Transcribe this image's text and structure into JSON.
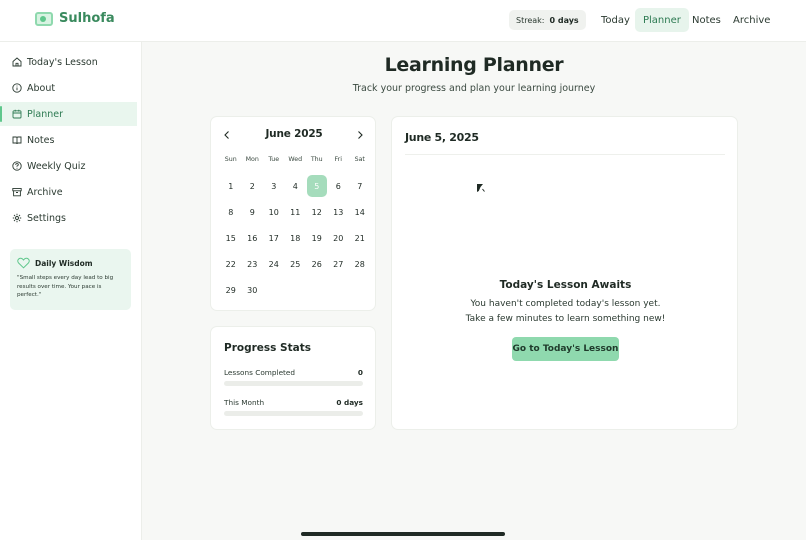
{
  "app": {
    "name": "Sulhofa"
  },
  "header": {
    "streak_label": "Streak:",
    "streak_value": "0 days",
    "nav": [
      {
        "label": "Today",
        "active": false
      },
      {
        "label": "Planner",
        "active": true
      },
      {
        "label": "Notes",
        "active": false
      },
      {
        "label": "Archive",
        "active": false
      }
    ]
  },
  "sidebar": {
    "items": [
      {
        "label": "Today's Lesson",
        "icon": "home-icon"
      },
      {
        "label": "About",
        "icon": "info-icon"
      },
      {
        "label": "Planner",
        "icon": "calendar-icon",
        "active": true
      },
      {
        "label": "Notes",
        "icon": "book-icon"
      },
      {
        "label": "Weekly Quiz",
        "icon": "help-circle-icon"
      },
      {
        "label": "Archive",
        "icon": "archive-icon"
      },
      {
        "label": "Settings",
        "icon": "gear-icon"
      }
    ],
    "wisdom": {
      "title": "Daily Wisdom",
      "icon": "heart-icon",
      "text": "\"Small steps every day lead to big results over time. Your pace is perfect.\""
    }
  },
  "main": {
    "title": "Learning Planner",
    "subtitle": "Track your progress and plan your learning journey"
  },
  "calendar": {
    "month_label": "June 2025",
    "weekdays": [
      "Sun",
      "Mon",
      "Tue",
      "Wed",
      "Thu",
      "Fri",
      "Sat"
    ],
    "weeks": [
      [
        "1",
        "2",
        "3",
        "4",
        "5",
        "6",
        "7"
      ],
      [
        "8",
        "9",
        "10",
        "11",
        "12",
        "13",
        "14"
      ],
      [
        "15",
        "16",
        "17",
        "18",
        "19",
        "20",
        "21"
      ],
      [
        "22",
        "23",
        "24",
        "25",
        "26",
        "27",
        "28"
      ],
      [
        "29",
        "30"
      ]
    ],
    "selected_day": "5"
  },
  "stats": {
    "title": "Progress Stats",
    "rows": [
      {
        "label": "Lessons Completed",
        "value": "0",
        "progress": 0
      },
      {
        "label": "This Month",
        "value": "0 days",
        "progress": 0
      }
    ]
  },
  "lesson": {
    "date": "June 5, 2025",
    "heading": "Today's Lesson Awaits",
    "message_line1": "You haven't completed today's lesson yet.",
    "message_line2": "Take a few minutes to learn something new!",
    "button_label": "Go to Today's Lesson"
  },
  "colors": {
    "accent": "#5fc78c",
    "accent_light": "#8fd9ae",
    "selected_day": "#a5dcbc",
    "active_bg": "#e9f6ee",
    "brand_text": "#3a8a5e"
  }
}
